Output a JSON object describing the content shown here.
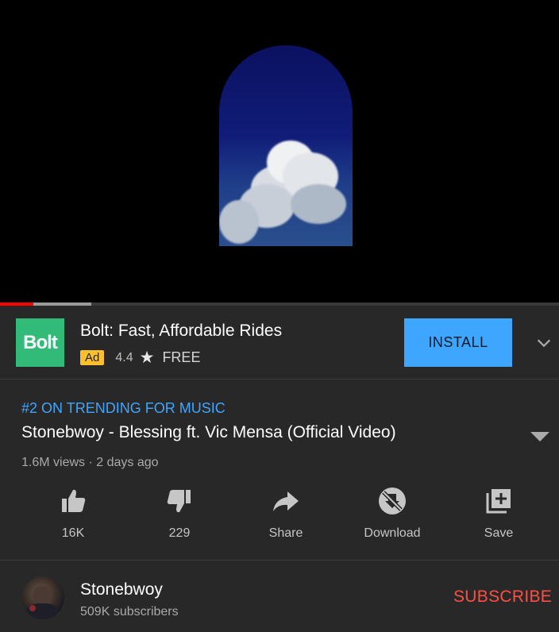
{
  "player": {
    "progress_played_fraction": 0.06,
    "progress_buffered_fraction": 0.163
  },
  "ad": {
    "logo_text": "Bolt",
    "title": "Bolt: Fast, Affordable Rides",
    "badge": "Ad",
    "rating": "4.4",
    "price": "FREE",
    "install_label": "INSTALL",
    "brand_color": "#32bb78"
  },
  "video": {
    "trending": "#2 ON TRENDING FOR MUSIC",
    "title": "Stonebwoy - Blessing ft. Vic Mensa (Official Video)",
    "views": "1.6M views · 2 days ago"
  },
  "actions": [
    {
      "icon": "thumbs-up-icon",
      "label": "16K"
    },
    {
      "icon": "thumbs-down-icon",
      "label": "229"
    },
    {
      "icon": "share-icon",
      "label": "Share"
    },
    {
      "icon": "download-disabled-icon",
      "label": "Download"
    },
    {
      "icon": "save-playlist-icon",
      "label": "Save"
    }
  ],
  "channel": {
    "name": "Stonebwoy",
    "subscribers": "509K subscribers",
    "subscribe_label": "SUBSCRIBE"
  },
  "colors": {
    "accent_blue": "#3ea6ff",
    "subscribe_red": "#ff4e45",
    "background": "#282828"
  }
}
